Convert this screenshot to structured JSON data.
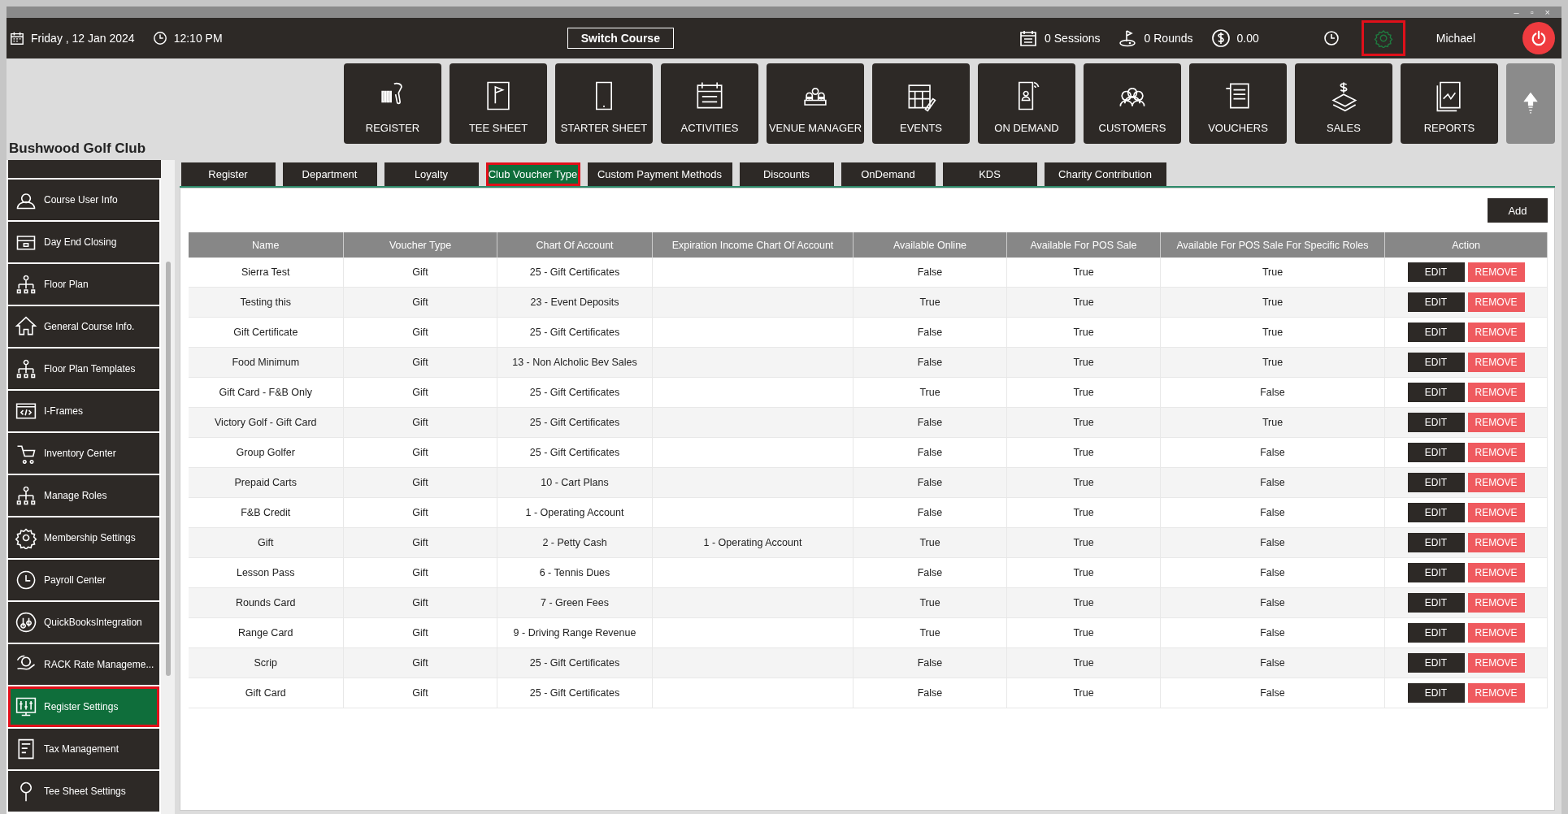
{
  "window": {
    "controls": [
      "–",
      "▫",
      "×"
    ]
  },
  "top_bar": {
    "date": "Friday ,  12 Jan 2024",
    "time": "12:10 PM",
    "switch_button": "Switch Course",
    "sessions": "0 Sessions",
    "rounds": "0 Rounds",
    "balance": "0.00",
    "settings_highlighted": true,
    "user": "Michael"
  },
  "nav_tiles": [
    {
      "label": "REGISTER"
    },
    {
      "label": "TEE SHEET"
    },
    {
      "label": "STARTER SHEET"
    },
    {
      "label": "ACTIVITIES"
    },
    {
      "label": "VENUE MANAGER"
    },
    {
      "label": "EVENTS"
    },
    {
      "label": "ON DEMAND"
    },
    {
      "label": "CUSTOMERS"
    },
    {
      "label": "VOUCHERS"
    },
    {
      "label": "SALES"
    },
    {
      "label": "REPORTS"
    }
  ],
  "club_name": "Bushwood Golf Club",
  "sidebar": {
    "items": [
      {
        "label": "Course User Info",
        "selected": false,
        "highlighted": false
      },
      {
        "label": "Day End Closing",
        "selected": false,
        "highlighted": false
      },
      {
        "label": "Floor Plan",
        "selected": false,
        "highlighted": false
      },
      {
        "label": "General Course Info.",
        "selected": false,
        "highlighted": false
      },
      {
        "label": "Floor Plan Templates",
        "selected": false,
        "highlighted": false
      },
      {
        "label": "I-Frames",
        "selected": false,
        "highlighted": false
      },
      {
        "label": "Inventory Center",
        "selected": false,
        "highlighted": false
      },
      {
        "label": "Manage Roles",
        "selected": false,
        "highlighted": false
      },
      {
        "label": "Membership Settings",
        "selected": false,
        "highlighted": false
      },
      {
        "label": "Payroll Center",
        "selected": false,
        "highlighted": false
      },
      {
        "label": "QuickBooksIntegration",
        "selected": false,
        "highlighted": false
      },
      {
        "label": "RACK Rate Manageme...",
        "selected": false,
        "highlighted": false
      },
      {
        "label": "Register Settings",
        "selected": true,
        "highlighted": true
      },
      {
        "label": "Tax Management",
        "selected": false,
        "highlighted": false
      },
      {
        "label": "Tee Sheet Settings",
        "selected": false,
        "highlighted": false
      }
    ]
  },
  "tabs": [
    {
      "label": "Register",
      "selected": false,
      "highlighted": false
    },
    {
      "label": "Department",
      "selected": false,
      "highlighted": false
    },
    {
      "label": "Loyalty",
      "selected": false,
      "highlighted": false
    },
    {
      "label": "Club Voucher Type",
      "selected": true,
      "highlighted": true
    },
    {
      "label": "Custom Payment Methods",
      "selected": false,
      "highlighted": false
    },
    {
      "label": "Discounts",
      "selected": false,
      "highlighted": false
    },
    {
      "label": "OnDemand",
      "selected": false,
      "highlighted": false
    },
    {
      "label": "KDS",
      "selected": false,
      "highlighted": false
    },
    {
      "label": "Charity Contribution",
      "selected": false,
      "highlighted": false
    }
  ],
  "add_button": "Add",
  "table": {
    "columns": [
      "Name",
      "Voucher Type",
      "Chart Of Account",
      "Expiration Income Chart Of Account",
      "Available Online",
      "Available For POS Sale",
      "Available For POS Sale For Specific Roles",
      "Action"
    ],
    "rows": [
      {
        "cells": [
          "Sierra Test",
          "Gift",
          "25 - Gift Certificates",
          "",
          "False",
          "True",
          "True"
        ],
        "actions": [
          "EDIT",
          "REMOVE"
        ]
      },
      {
        "cells": [
          "Testing this",
          "Gift",
          "23 - Event Deposits",
          "",
          "True",
          "True",
          "True"
        ],
        "actions": [
          "EDIT",
          "REMOVE"
        ]
      },
      {
        "cells": [
          "Gift Certificate",
          "Gift",
          "25 - Gift Certificates",
          "",
          "False",
          "True",
          "True"
        ],
        "actions": [
          "EDIT",
          "REMOVE"
        ]
      },
      {
        "cells": [
          "Food Minimum",
          "Gift",
          "13 - Non Alcholic Bev Sales",
          "",
          "False",
          "True",
          "True"
        ],
        "actions": [
          "EDIT",
          "REMOVE"
        ]
      },
      {
        "cells": [
          "Gift Card - F&B Only",
          "Gift",
          "25 - Gift Certificates",
          "",
          "True",
          "True",
          "False"
        ],
        "actions": [
          "EDIT",
          "REMOVE"
        ]
      },
      {
        "cells": [
          "Victory Golf - Gift Card",
          "Gift",
          "25 - Gift Certificates",
          "",
          "False",
          "True",
          "True"
        ],
        "actions": [
          "EDIT",
          "REMOVE"
        ]
      },
      {
        "cells": [
          "Group Golfer",
          "Gift",
          "25 - Gift Certificates",
          "",
          "False",
          "True",
          "False"
        ],
        "actions": [
          "EDIT",
          "REMOVE"
        ]
      },
      {
        "cells": [
          "Prepaid Carts",
          "Gift",
          "10 - Cart Plans",
          "",
          "False",
          "True",
          "False"
        ],
        "actions": [
          "EDIT",
          "REMOVE"
        ]
      },
      {
        "cells": [
          "F&B Credit",
          "Gift",
          "1 - Operating Account",
          "",
          "False",
          "True",
          "False"
        ],
        "actions": [
          "EDIT",
          "REMOVE"
        ]
      },
      {
        "cells": [
          "Gift",
          "Gift",
          "2 - Petty Cash",
          "1 - Operating Account",
          "True",
          "True",
          "False"
        ],
        "actions": [
          "EDIT",
          "REMOVE"
        ]
      },
      {
        "cells": [
          "Lesson Pass",
          "Gift",
          "6 - Tennis Dues",
          "",
          "False",
          "True",
          "False"
        ],
        "actions": [
          "EDIT",
          "REMOVE"
        ]
      },
      {
        "cells": [
          "Rounds Card",
          "Gift",
          "7 - Green Fees",
          "",
          "True",
          "True",
          "False"
        ],
        "actions": [
          "EDIT",
          "REMOVE"
        ]
      },
      {
        "cells": [
          "Range Card",
          "Gift",
          "9 - Driving Range Revenue",
          "",
          "True",
          "True",
          "False"
        ],
        "actions": [
          "EDIT",
          "REMOVE"
        ]
      },
      {
        "cells": [
          "Scrip",
          "Gift",
          "25 - Gift Certificates",
          "",
          "False",
          "True",
          "False"
        ],
        "actions": [
          "EDIT",
          "REMOVE"
        ]
      },
      {
        "cells": [
          "Gift Card",
          "Gift",
          "25 - Gift Certificates",
          "",
          "False",
          "True",
          "False"
        ],
        "actions": [
          "EDIT",
          "REMOVE"
        ]
      }
    ]
  }
}
